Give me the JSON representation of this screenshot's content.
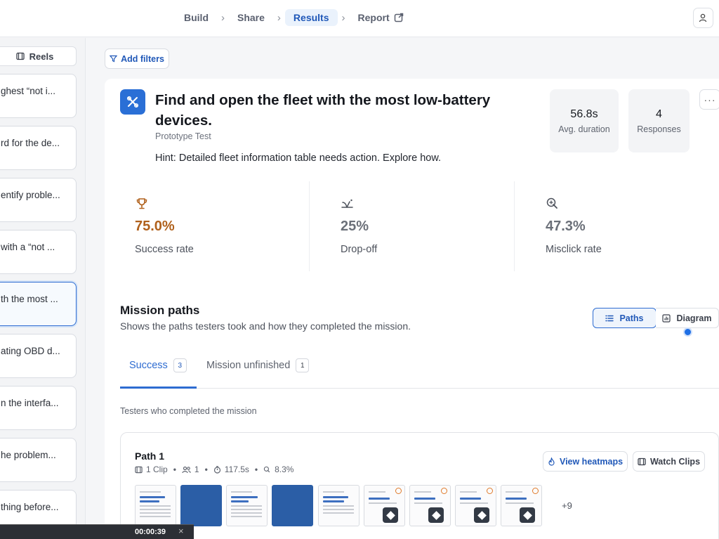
{
  "nav": {
    "items": [
      {
        "label": "Build"
      },
      {
        "label": "Share"
      },
      {
        "label": "Results"
      },
      {
        "label": "Report"
      }
    ],
    "separator": ">"
  },
  "sidebar": {
    "reels_label": "Reels",
    "missions": [
      {
        "text": "ghest “not i..."
      },
      {
        "text": "rd for the de..."
      },
      {
        "text": "entify proble..."
      },
      {
        "text": "with a “not ..."
      },
      {
        "text": "th the most ..."
      },
      {
        "text": "ating OBD d..."
      },
      {
        "text": "n the interfa..."
      },
      {
        "text": "he problem..."
      },
      {
        "text": "thing before..."
      }
    ]
  },
  "filters": {
    "add_label": "Add filters"
  },
  "task": {
    "title": "Find and open the fleet with the most low-battery devices.",
    "type": "Prototype Test",
    "hint": "Hint: Detailed fleet information table needs action. Explore how.",
    "avg_duration": {
      "value": "56.8s",
      "label": "Avg. duration"
    },
    "responses": {
      "value": "4",
      "label": "Responses"
    },
    "more_label": "···"
  },
  "metrics": [
    {
      "value": "75.0%",
      "label": "Success rate",
      "icon": "trophy-icon",
      "color": "#b0611c"
    },
    {
      "value": "25%",
      "label": "Drop-off",
      "icon": "drop-off-icon",
      "color": "#6b7079"
    },
    {
      "value": "47.3%",
      "label": "Misclick rate",
      "icon": "misclick-icon",
      "color": "#6b7079"
    }
  ],
  "mission_paths": {
    "title": "Mission paths",
    "subtitle": "Shows the paths testers took and how they completed the mission.",
    "view_paths": "Paths",
    "view_diagram": "Diagram",
    "tabs": [
      {
        "label": "Success",
        "count": "3"
      },
      {
        "label": "Mission unfinished",
        "count": "1"
      }
    ],
    "completed_label": "Testers who completed the mission",
    "path": {
      "title": "Path 1",
      "clips": "1 Clip",
      "testers": "1",
      "duration": "117.5s",
      "misclick": "8.3%",
      "view_heatmaps": "View heatmaps",
      "watch_clips": "Watch Clips",
      "more_count": "+9"
    }
  },
  "video": {
    "time": "00:00:39",
    "close": "×"
  },
  "colors": {
    "accent": "#2e6cd1",
    "success": "#b0611c"
  }
}
